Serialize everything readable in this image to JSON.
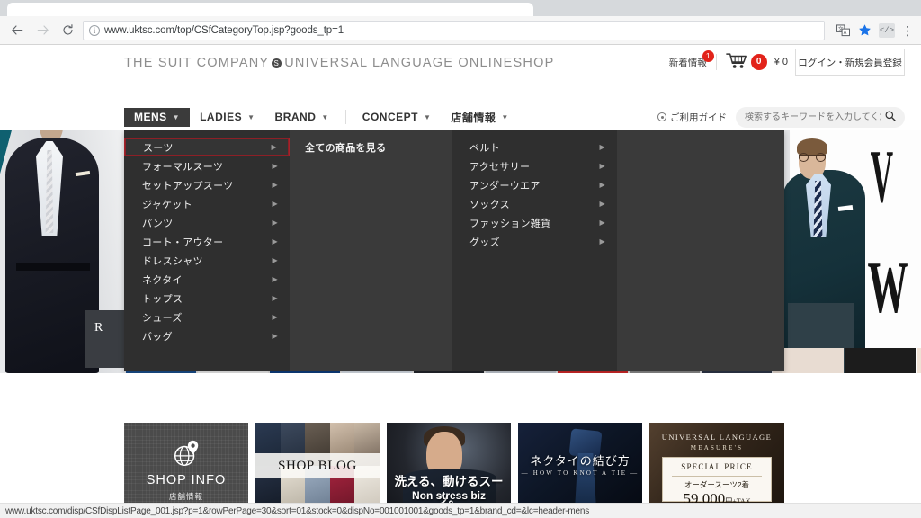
{
  "browser": {
    "back_label": "Back",
    "forward_label": "Forward",
    "reload_label": "Reload",
    "url": "www.uktsc.com/top/CSfCategoryTop.jsp?goods_tp=1",
    "url_host": "www.uktsc.com",
    "url_path": "/top/CSfCategoryTop.jsp?goods_tp=1",
    "info_icon": "info-icon",
    "translate_icon": "translate-icon",
    "bookmark_icon": "star-icon",
    "extension_icon": "</>",
    "menu_icon": "kebab-menu-icon"
  },
  "status_bar": {
    "link_url": "www.uktsc.com/disp/CSfDispListPage_001.jsp?p=1&rowPerPage=30&sort=01&stock=0&dispNo=001001001&goods_tp=1&brand_cd=&lc=header-mens"
  },
  "header": {
    "brand_part1": "THE SUIT COMPANY",
    "brand_bullet": "S",
    "brand_part2": "UNIVERSAL LANGUAGE ONLINESHOP",
    "news_label": "新着情報",
    "news_badge": "1",
    "cart_icon": "shopping-cart-icon",
    "cart_badge": "0",
    "cart_price": "¥ 0",
    "login_label": "ログイン・新規会員登録"
  },
  "gnav": {
    "items": [
      {
        "label": "MENS",
        "active": true
      },
      {
        "label": "LADIES",
        "active": false
      },
      {
        "label": "BRAND",
        "active": false
      },
      {
        "label": "CONCEPT",
        "active": false
      },
      {
        "label": "店舗情報",
        "active": false
      }
    ],
    "guide_label": "ご利用ガイド",
    "search_placeholder": "検索するキーワードを入力してください",
    "search_value": "",
    "search_icon": "search-icon"
  },
  "megamenu": {
    "column1": [
      {
        "label": "スーツ",
        "selected": true
      },
      {
        "label": "フォーマルスーツ",
        "selected": false
      },
      {
        "label": "セットアップスーツ",
        "selected": false
      },
      {
        "label": "ジャケット",
        "selected": false
      },
      {
        "label": "パンツ",
        "selected": false
      },
      {
        "label": "コート・アウター",
        "selected": false
      },
      {
        "label": "ドレスシャツ",
        "selected": false
      },
      {
        "label": "ネクタイ",
        "selected": false
      },
      {
        "label": "トップス",
        "selected": false
      },
      {
        "label": "シューズ",
        "selected": false
      },
      {
        "label": "バッグ",
        "selected": false
      }
    ],
    "column2": [
      {
        "label": "全ての商品を見る"
      }
    ],
    "column3": [
      {
        "label": "ベルト"
      },
      {
        "label": "アクセサリー"
      },
      {
        "label": "アンダーウエア"
      },
      {
        "label": "ソックス"
      },
      {
        "label": "ファッション雑貨"
      },
      {
        "label": "グッズ"
      }
    ]
  },
  "hero": {
    "left_card_letter": "R",
    "right_letter_1": "V",
    "right_letter_2": "W"
  },
  "banners": [
    {
      "name": "shop-info",
      "icon": "globe-pin-icon",
      "title": "SHOP INFO",
      "subtitle": "店舗情報"
    },
    {
      "name": "shop-blog",
      "title": "SHOP BLOG"
    },
    {
      "name": "non-stress-biz",
      "title": "洗える、動けるスーツ。",
      "subtitle": "Non stress biz"
    },
    {
      "name": "how-to-knot-a-tie",
      "title": "ネクタイの結び方",
      "subtitle": "— HOW TO KNOT A TIE —"
    },
    {
      "name": "order-suit-special-price",
      "brand_line1": "UNIVERSAL LANGUAGE",
      "brand_line2": "MEASURE'S",
      "special_label": "SPECIAL PRICE",
      "item_label": "オーダースーツ2着",
      "price": "59,000",
      "price_suffix": "円+TAX"
    }
  ],
  "colors": {
    "accent_red": "#e2231a",
    "menu_dark": "#2f2f2f",
    "menu_dark_alt": "#3a3a3a",
    "nav_active": "#3b3b3b",
    "select_border": "#a3232b"
  }
}
